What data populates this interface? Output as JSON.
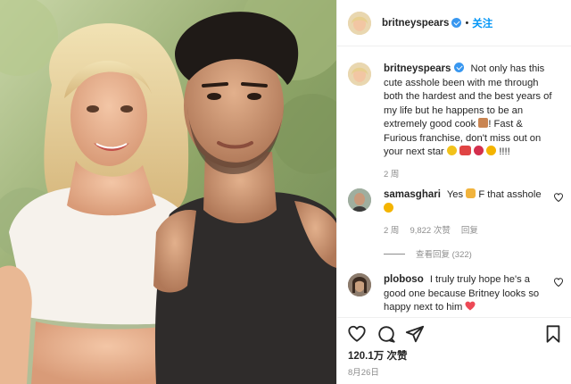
{
  "post": {
    "author": "britneyspears",
    "follow_label": "关注",
    "separator": "•",
    "likes_text": "120.1万 次赞",
    "date_text": "8月26日"
  },
  "caption": {
    "username": "britneyspears",
    "text_part1": "Not only has this cute asshole been with me through both the hardest and the best years of my life but he happens to be an extremely good cook",
    "text_part2": "! Fast & Furious franchise, don't miss out on your next star",
    "text_part3": "!!!!",
    "time": "2 周"
  },
  "comments": [
    {
      "username": "samasghari",
      "text_part1": "Yes",
      "text_part2": "F that asshole",
      "time": "2 周",
      "likes": "9,822 次赞",
      "reply_label": "回复",
      "view_replies": "查看回复 (322)"
    },
    {
      "username": "ploboso",
      "text": "I truly truly hope he's a good one because Britney looks so happy next to him"
    }
  ],
  "icons": {
    "like": "heart-icon",
    "comment": "comment-icon",
    "share": "share-icon",
    "save": "bookmark-icon"
  },
  "colors": {
    "accent": "#0095f6",
    "verified": "#3897f0",
    "text": "#262626",
    "muted": "#8e8e8e",
    "heart_emoji": "#ed4956"
  }
}
